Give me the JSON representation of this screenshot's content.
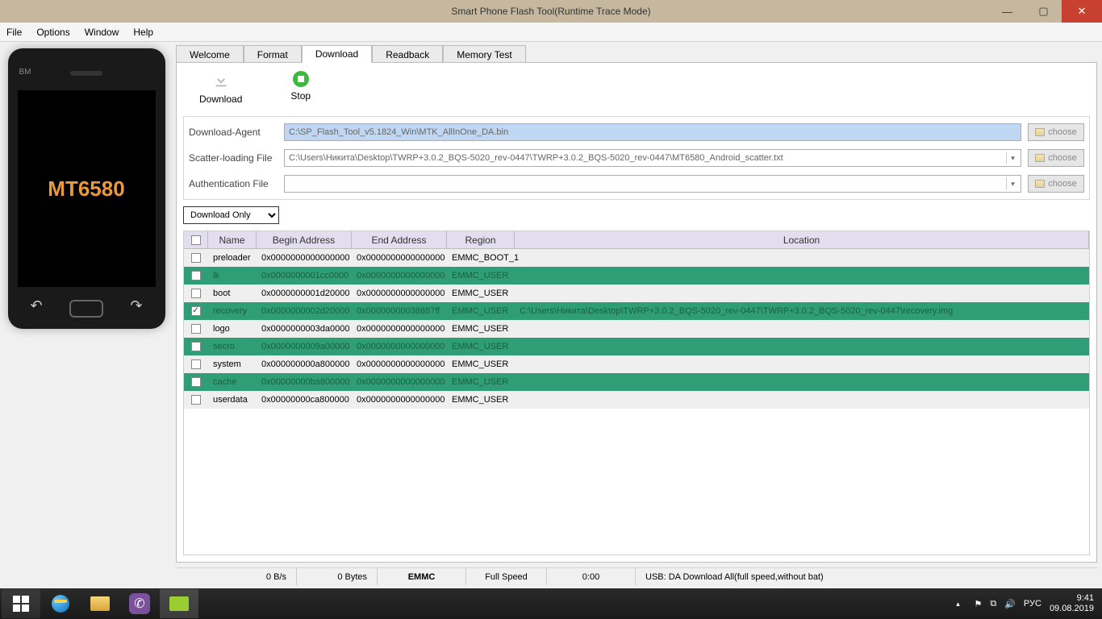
{
  "window": {
    "title": "Smart Phone Flash Tool(Runtime Trace Mode)"
  },
  "menubar": [
    "File",
    "Options",
    "Window",
    "Help"
  ],
  "phone": {
    "brand": "BM",
    "chip": "MT6580"
  },
  "tabs": {
    "items": [
      "Welcome",
      "Format",
      "Download",
      "Readback",
      "Memory Test"
    ],
    "active": "Download"
  },
  "toolbar": {
    "download": "Download",
    "stop": "Stop"
  },
  "files": {
    "da_label": "Download-Agent",
    "da_value": "C:\\SP_Flash_Tool_v5.1824_Win\\MTK_AllInOne_DA.bin",
    "scatter_label": "Scatter-loading File",
    "scatter_value": "C:\\Users\\Никита\\Desktop\\TWRP+3.0.2_BQS-5020_rev-0447\\TWRP+3.0.2_BQS-5020_rev-0447\\MT6580_Android_scatter.txt",
    "auth_label": "Authentication File",
    "auth_value": "",
    "choose": "choose"
  },
  "mode": {
    "selected": "Download Only"
  },
  "table": {
    "headers": {
      "name": "Name",
      "begin": "Begin Address",
      "end": "End Address",
      "region": "Region",
      "location": "Location"
    },
    "rows": [
      {
        "checked": false,
        "green": false,
        "name": "preloader",
        "begin": "0x0000000000000000",
        "end": "0x0000000000000000",
        "region": "EMMC_BOOT_1",
        "location": ""
      },
      {
        "checked": false,
        "green": true,
        "name": "lk",
        "begin": "0x0000000001cc0000",
        "end": "0x0000000000000000",
        "region": "EMMC_USER",
        "location": ""
      },
      {
        "checked": false,
        "green": false,
        "name": "boot",
        "begin": "0x0000000001d20000",
        "end": "0x0000000000000000",
        "region": "EMMC_USER",
        "location": ""
      },
      {
        "checked": true,
        "green": true,
        "name": "recovery",
        "begin": "0x0000000002d20000",
        "end": "0x00000000038887ff",
        "region": "EMMC_USER",
        "location": "C:\\Users\\Никита\\Desktop\\TWRP+3.0.2_BQS-5020_rev-0447\\TWRP+3.0.2_BQS-5020_rev-0447\\recovery.img"
      },
      {
        "checked": false,
        "green": false,
        "name": "logo",
        "begin": "0x0000000003da0000",
        "end": "0x0000000000000000",
        "region": "EMMC_USER",
        "location": ""
      },
      {
        "checked": false,
        "green": true,
        "name": "secro",
        "begin": "0x0000000009a00000",
        "end": "0x0000000000000000",
        "region": "EMMC_USER",
        "location": ""
      },
      {
        "checked": false,
        "green": false,
        "name": "system",
        "begin": "0x000000000a800000",
        "end": "0x0000000000000000",
        "region": "EMMC_USER",
        "location": ""
      },
      {
        "checked": false,
        "green": true,
        "name": "cache",
        "begin": "0x00000000ba800000",
        "end": "0x0000000000000000",
        "region": "EMMC_USER",
        "location": ""
      },
      {
        "checked": false,
        "green": false,
        "name": "userdata",
        "begin": "0x00000000ca800000",
        "end": "0x0000000000000000",
        "region": "EMMC_USER",
        "location": ""
      }
    ]
  },
  "statusbar": {
    "speed": "0 B/s",
    "bytes": "0 Bytes",
    "storage": "EMMC",
    "link": "Full Speed",
    "time": "0:00",
    "usb": "USB: DA Download All(full speed,without bat)"
  },
  "taskbar": {
    "lang": "РУС",
    "time": "9:41",
    "date": "09.08.2019"
  }
}
